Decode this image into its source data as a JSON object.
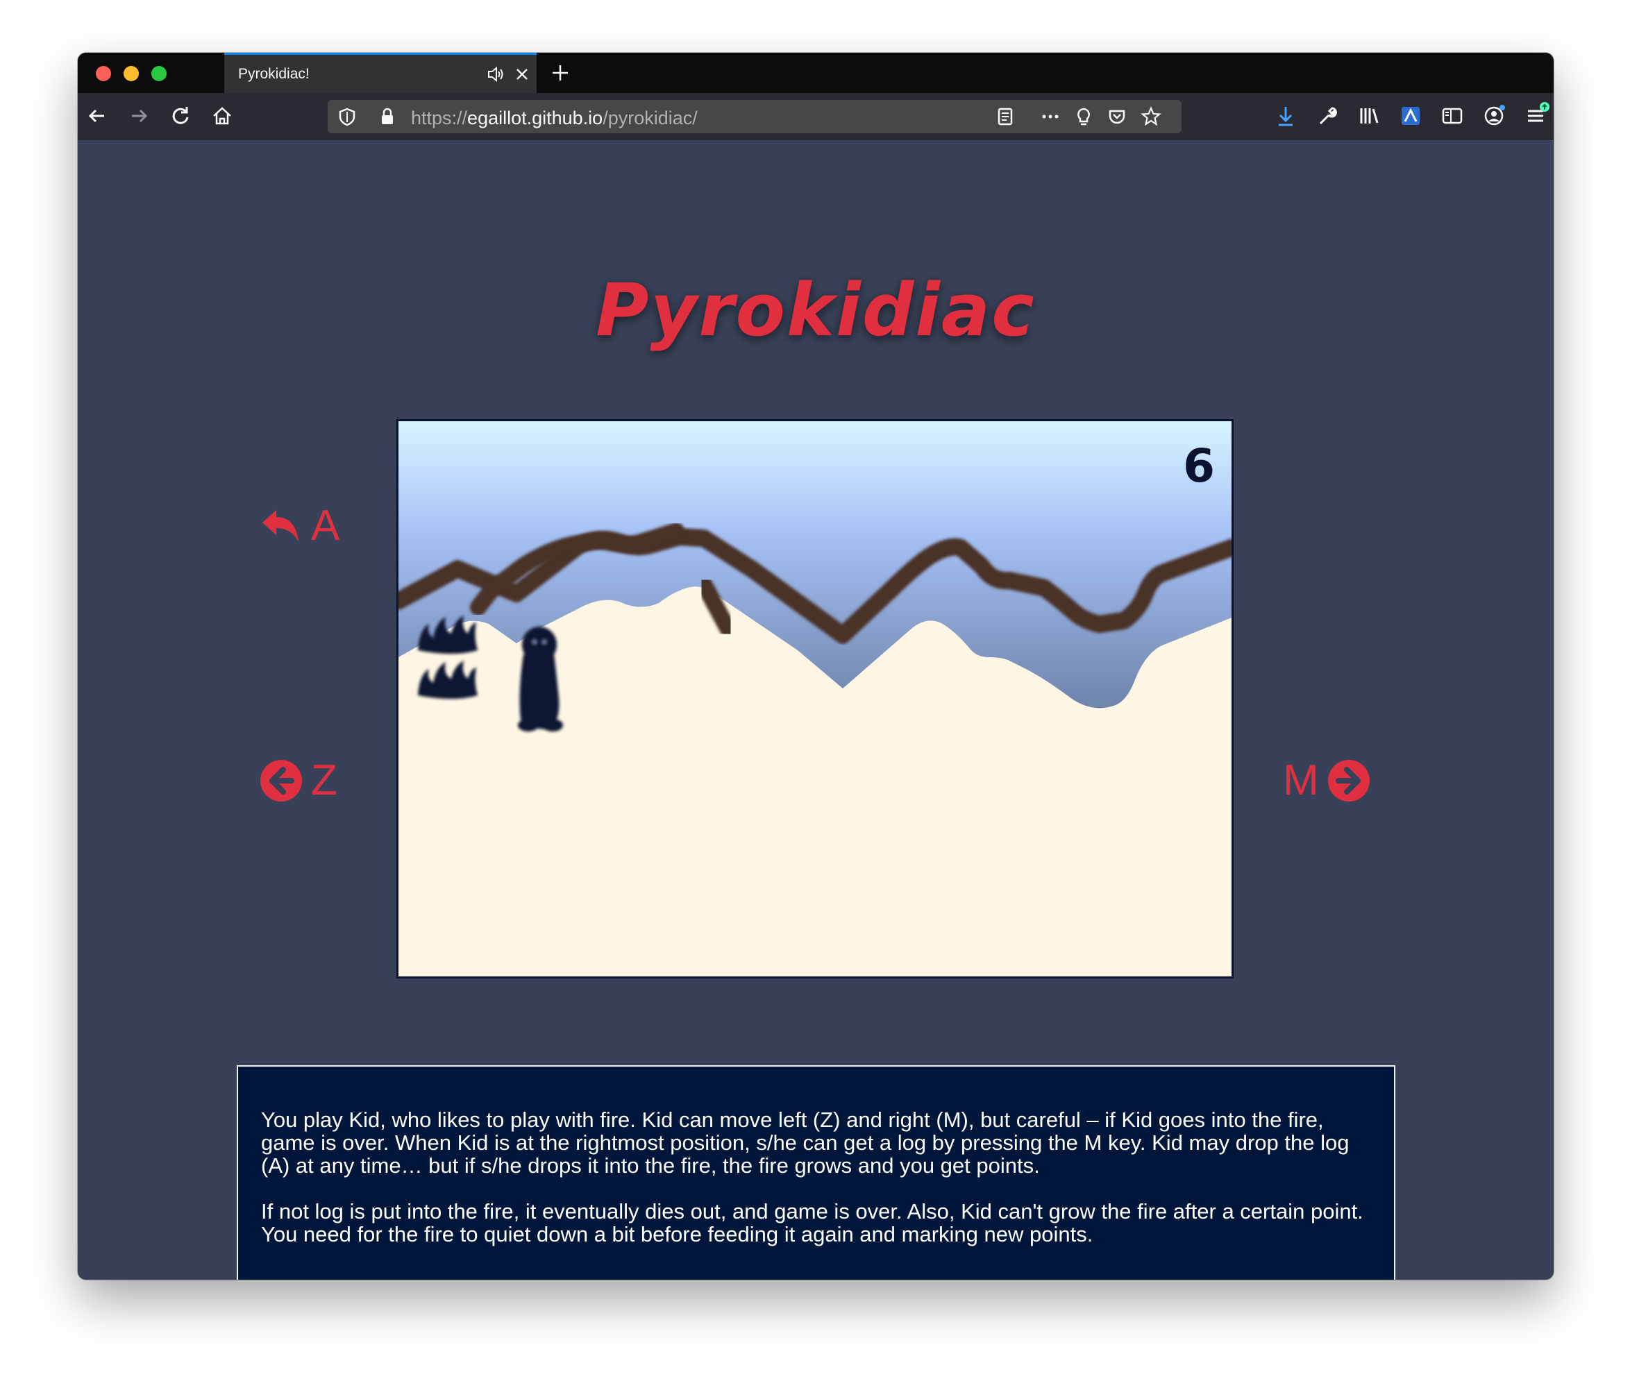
{
  "browser": {
    "tab_title": "Pyrokidiac!",
    "url_scheme": "https://",
    "url_host": "egaillot.github.io",
    "url_path": "/pyrokidiac/"
  },
  "page": {
    "logo": "Pyrokidiac",
    "score": "6",
    "controls": {
      "drop": {
        "key": "A",
        "icon": "undo-arrow-icon"
      },
      "left": {
        "key": "Z",
        "icon": "arrow-circle-left-icon"
      },
      "right": {
        "key": "M",
        "icon": "arrow-circle-right-icon"
      }
    },
    "instructions": [
      "You play Kid, who likes to play with fire. Kid can move left (Z) and right (M), but careful – if Kid goes into the fire, game is over. When Kid is at the rightmost position, s/he can get a log by pressing the M key. Kid may drop the log (A) at any time… but if s/he drops it into the fire, the fire grows and you get points.",
      "If not log is put into the fire, it eventually dies out, and game is over. Also, Kid can't grow the fire after a certain point. You need for the fire to quiet down a bit before feeding it again and marking new points."
    ]
  },
  "colors": {
    "accent": "#e03040",
    "page_bg": "#384157",
    "panel_bg": "#00163a",
    "ink": "#0b1330",
    "snow": "#fdf6e4"
  }
}
